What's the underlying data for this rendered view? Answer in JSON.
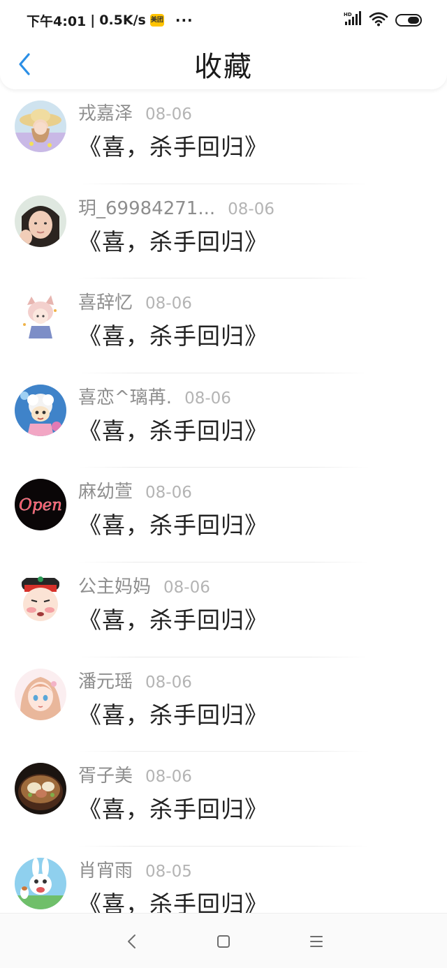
{
  "status_bar": {
    "time": "下午4:01",
    "separator": "|",
    "net_speed": "0.5K/s",
    "app_badge": "美团",
    "more": "···",
    "icons": [
      "hd-signal-icon",
      "wifi-icon",
      "battery-icon"
    ]
  },
  "header": {
    "title": "收藏",
    "back_icon": "chevron-left-icon",
    "accent_color": "#2b8fe6"
  },
  "items": [
    {
      "name": "戎嘉泽",
      "date": "08-06",
      "text": "《喜，杀手回归》"
    },
    {
      "name": "玥_69984271...",
      "date": "08-06",
      "text": "《喜，杀手回归》"
    },
    {
      "name": "喜辞忆",
      "date": "08-06",
      "text": "《喜，杀手回归》"
    },
    {
      "name": "喜恋^璃苒.",
      "date": "08-06",
      "text": "《喜，杀手回归》"
    },
    {
      "name": "麻幼萱",
      "date": "08-06",
      "text": "《喜，杀手回归》"
    },
    {
      "name": "公主妈妈",
      "date": "08-06",
      "text": "《喜，杀手回归》"
    },
    {
      "name": "潘元瑶",
      "date": "08-06",
      "text": "《喜，杀手回归》"
    },
    {
      "name": "胥子美",
      "date": "08-06",
      "text": "《喜，杀手回归》"
    },
    {
      "name": "肖宵雨",
      "date": "08-05",
      "text": "《喜，杀手回归》"
    }
  ],
  "avatar_5_sign": "Open",
  "nav": {
    "icons": [
      "back-triangle-icon",
      "home-square-icon",
      "menu-lines-icon"
    ]
  }
}
